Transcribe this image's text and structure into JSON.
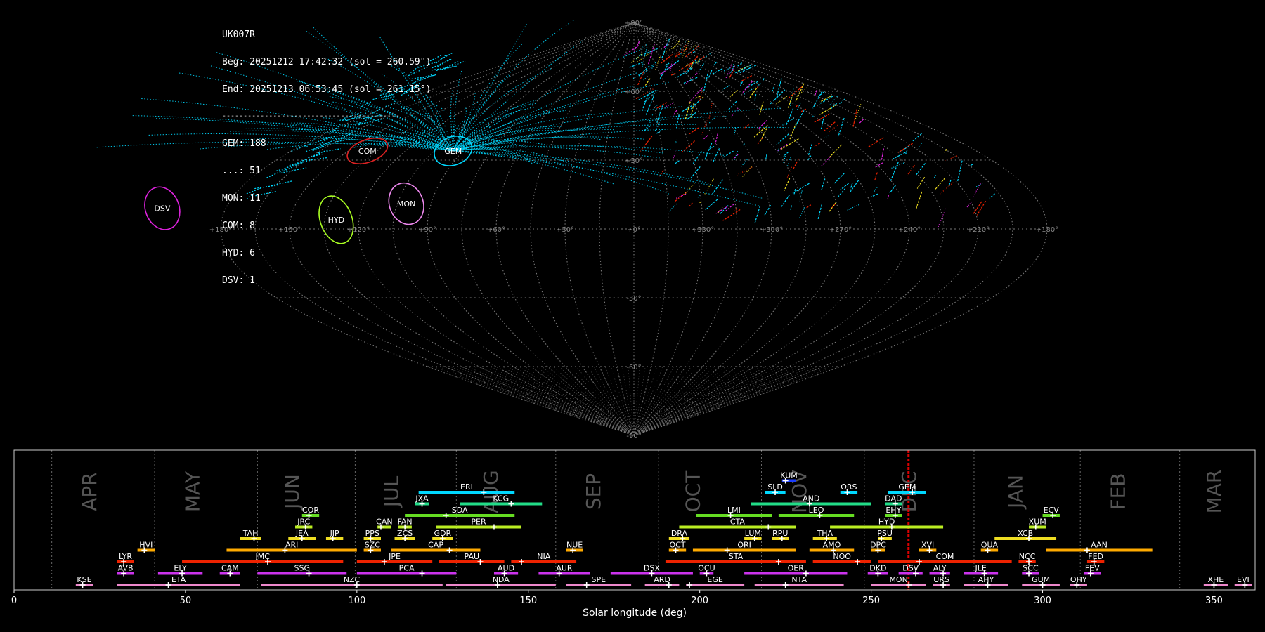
{
  "info_text": {
    "station": "UK007R",
    "begin": "Beg: 20251212 17:42:32 (sol = 260.59°)",
    "end": "End: 20251213 06:53:45 (sol = 261.15°)",
    "separator": "------------------------------------------",
    "counts": [
      "GEM: 188",
      "...: 51",
      "MON: 11",
      "COM: 8",
      "HYD: 6",
      "DSV: 1"
    ]
  },
  "colors": {
    "background": "#000000",
    "meteor_cyan": "#00d8ff",
    "grid": "#777777",
    "tick_text": "#888888",
    "month_text": "#555555",
    "sol_marker": "#dd0000",
    "frame": "#cccccc"
  },
  "chart_data": [
    {
      "type": "scatter",
      "projection": "sinusoidal (all-sky, ecliptic-centered longitude)",
      "x_tick_labels": [
        "+180°",
        "+150°",
        "+120°",
        "+90°",
        "+60°",
        "+30°",
        "+0°",
        "+330°",
        "+300°",
        "+270°",
        "+240°",
        "+210°",
        "+180°"
      ],
      "y_tick_labels": [
        "+90°",
        "+60°",
        "+30°",
        "-30°",
        "-60°",
        "-90°"
      ],
      "radiants": [
        {
          "code": "GEM",
          "lon": 95,
          "lat": 34,
          "rx": 0.55,
          "ry": 0.4,
          "color": "#00d8ff"
        },
        {
          "code": "COM",
          "lon": 140,
          "lat": 34,
          "rx": 0.6,
          "ry": 0.32,
          "color": "#dd2222"
        },
        {
          "code": "MON",
          "lon": 101,
          "lat": 11,
          "rx": 0.48,
          "ry": 0.6,
          "color": "#ee88ee"
        },
        {
          "code": "HYD",
          "lon": 130,
          "lat": 4,
          "rx": 0.45,
          "ry": 0.7,
          "color": "#aaff22"
        },
        {
          "code": "DSV",
          "lon": 208,
          "lat": 9,
          "rx": 0.48,
          "ry": 0.62,
          "color": "#dd22dd"
        }
      ]
    },
    {
      "type": "timeline",
      "xlabel": "Solar longitude (deg)",
      "xlim": [
        0,
        362
      ],
      "x_ticks": [
        0,
        50,
        100,
        150,
        200,
        250,
        300,
        350
      ],
      "current_sol": 260.9,
      "month_boundaries": [
        11,
        41,
        71,
        99.5,
        129,
        158,
        188,
        218,
        248,
        280,
        311,
        340
      ],
      "months": [
        {
          "name": "APR",
          "at": 24
        },
        {
          "name": "MAY",
          "at": 54
        },
        {
          "name": "JUN",
          "at": 83
        },
        {
          "name": "JUL",
          "at": 112
        },
        {
          "name": "AUG",
          "at": 141
        },
        {
          "name": "SEP",
          "at": 171
        },
        {
          "name": "OCT",
          "at": 200
        },
        {
          "name": "NOV",
          "at": 231
        },
        {
          "name": "DEC",
          "at": 263
        },
        {
          "name": "JAN",
          "at": 294
        },
        {
          "name": "FEB",
          "at": 324
        },
        {
          "name": "MAR",
          "at": 352
        }
      ],
      "showers": [
        {
          "code": "KUM",
          "s": 224,
          "e": 228,
          "p": 225,
          "row": 9,
          "color": "#1a3cff"
        },
        {
          "code": "ERI",
          "s": 118,
          "e": 146,
          "p": 137,
          "row": 8,
          "color": "#00d8ff"
        },
        {
          "code": "SLD",
          "s": 219,
          "e": 225,
          "p": 222,
          "row": 8,
          "color": "#00d8ff"
        },
        {
          "code": "ORS",
          "s": 241,
          "e": 246,
          "p": 243,
          "row": 8,
          "color": "#00d8ff"
        },
        {
          "code": "GEM",
          "s": 255,
          "e": 266,
          "p": 262,
          "row": 8,
          "color": "#00d8ff"
        },
        {
          "code": "JXA",
          "s": 117,
          "e": 121,
          "p": 119,
          "row": 7,
          "color": "#22dd88"
        },
        {
          "code": "KCG",
          "s": 130,
          "e": 154,
          "p": 145,
          "row": 7,
          "color": "#22dd88"
        },
        {
          "code": "AND",
          "s": 215,
          "e": 250,
          "p": 232,
          "row": 7,
          "color": "#22dd88"
        },
        {
          "code": "DAD",
          "s": 254,
          "e": 259,
          "p": 257,
          "row": 7,
          "color": "#22dd88"
        },
        {
          "code": "COR",
          "s": 84,
          "e": 89,
          "p": 86,
          "row": 6,
          "color": "#66dd22"
        },
        {
          "code": "SDA",
          "s": 114,
          "e": 146,
          "p": 126,
          "row": 6,
          "color": "#66dd22"
        },
        {
          "code": "LMI",
          "s": 199,
          "e": 221,
          "p": 209,
          "row": 6,
          "color": "#66dd22"
        },
        {
          "code": "LEO",
          "s": 223,
          "e": 245,
          "p": 235,
          "row": 6,
          "color": "#66dd22"
        },
        {
          "code": "EHY",
          "s": 254,
          "e": 259,
          "p": 257,
          "row": 6,
          "color": "#66dd22"
        },
        {
          "code": "ECV",
          "s": 300,
          "e": 305,
          "p": 303,
          "row": 6,
          "color": "#66dd22"
        },
        {
          "code": "JRC",
          "s": 82,
          "e": 87,
          "p": 85,
          "row": 5,
          "color": "#bbee22"
        },
        {
          "code": "CAN",
          "s": 106,
          "e": 110,
          "p": 107,
          "row": 5,
          "color": "#bbee22"
        },
        {
          "code": "FAN",
          "s": 112,
          "e": 116,
          "p": 114,
          "row": 5,
          "color": "#bbee22"
        },
        {
          "code": "PER",
          "s": 123,
          "e": 148,
          "p": 140,
          "row": 5,
          "color": "#bbee22"
        },
        {
          "code": "CTA",
          "s": 194,
          "e": 228,
          "p": 220,
          "row": 5,
          "color": "#bbee22"
        },
        {
          "code": "HYD",
          "s": 238,
          "e": 271,
          "p": 256,
          "row": 5,
          "color": "#bbee22"
        },
        {
          "code": "XUM",
          "s": 296,
          "e": 301,
          "p": 298,
          "row": 5,
          "color": "#bbee22"
        },
        {
          "code": "TAH",
          "s": 66,
          "e": 72,
          "p": 70,
          "row": 4,
          "color": "#eedd22"
        },
        {
          "code": "JEA",
          "s": 80,
          "e": 88,
          "p": 84,
          "row": 4,
          "color": "#eedd22"
        },
        {
          "code": "JIP",
          "s": 91,
          "e": 96,
          "p": 93,
          "row": 4,
          "color": "#eedd22"
        },
        {
          "code": "PPS",
          "s": 102,
          "e": 107,
          "p": 104,
          "row": 4,
          "color": "#eedd22"
        },
        {
          "code": "ZCS",
          "s": 111,
          "e": 117,
          "p": 114,
          "row": 4,
          "color": "#eedd22"
        },
        {
          "code": "GDR",
          "s": 122,
          "e": 128,
          "p": 125,
          "row": 4,
          "color": "#eedd22"
        },
        {
          "code": "DRA",
          "s": 191,
          "e": 197,
          "p": 195,
          "row": 4,
          "color": "#eedd22"
        },
        {
          "code": "LUM",
          "s": 213,
          "e": 218,
          "p": 216,
          "row": 4,
          "color": "#eedd22"
        },
        {
          "code": "RPU",
          "s": 221,
          "e": 226,
          "p": 224,
          "row": 4,
          "color": "#eedd22"
        },
        {
          "code": "THA",
          "s": 233,
          "e": 240,
          "p": 237,
          "row": 4,
          "color": "#eedd22"
        },
        {
          "code": "PSU",
          "s": 252,
          "e": 256,
          "p": 253,
          "row": 4,
          "color": "#eedd22"
        },
        {
          "code": "XCB",
          "s": 286,
          "e": 304,
          "p": 296,
          "row": 4,
          "color": "#eedd22"
        },
        {
          "code": "HVI",
          "s": 36,
          "e": 41,
          "p": 38,
          "row": 3,
          "color": "#ffaa00"
        },
        {
          "code": "ARI",
          "s": 62,
          "e": 100,
          "p": 79,
          "row": 3,
          "color": "#ffaa00"
        },
        {
          "code": "SZC",
          "s": 102,
          "e": 107,
          "p": 104,
          "row": 3,
          "color": "#ffaa00"
        },
        {
          "code": "CAP",
          "s": 110,
          "e": 136,
          "p": 127,
          "row": 3,
          "color": "#ffaa00"
        },
        {
          "code": "NUE",
          "s": 161,
          "e": 166,
          "p": 163,
          "row": 3,
          "color": "#ffaa00"
        },
        {
          "code": "OCT",
          "s": 191,
          "e": 196,
          "p": 193,
          "row": 3,
          "color": "#ffaa00"
        },
        {
          "code": "ORI",
          "s": 198,
          "e": 228,
          "p": 208,
          "row": 3,
          "color": "#ffaa00"
        },
        {
          "code": "AMO",
          "s": 232,
          "e": 245,
          "p": 239,
          "row": 3,
          "color": "#ffaa00"
        },
        {
          "code": "DPC",
          "s": 250,
          "e": 254,
          "p": 252,
          "row": 3,
          "color": "#ffaa00"
        },
        {
          "code": "XVI",
          "s": 264,
          "e": 269,
          "p": 267,
          "row": 3,
          "color": "#ffaa00"
        },
        {
          "code": "QUA",
          "s": 282,
          "e": 287,
          "p": 284,
          "row": 3,
          "color": "#ffaa00"
        },
        {
          "code": "AAN",
          "s": 301,
          "e": 332,
          "p": 313,
          "row": 3,
          "color": "#ffaa00"
        },
        {
          "code": "LYR",
          "s": 30,
          "e": 35,
          "p": 32,
          "row": 2,
          "color": "#ee2200"
        },
        {
          "code": "JMC",
          "s": 49,
          "e": 96,
          "p": 74,
          "row": 2,
          "color": "#ee2200"
        },
        {
          "code": "JPE",
          "s": 100,
          "e": 122,
          "p": 108,
          "row": 2,
          "color": "#ee2200"
        },
        {
          "code": "PAU",
          "s": 124,
          "e": 143,
          "p": 136,
          "row": 2,
          "color": "#ee2200"
        },
        {
          "code": "NIA",
          "s": 145,
          "e": 164,
          "p": 148,
          "row": 2,
          "color": "#ee2200"
        },
        {
          "code": "STA",
          "s": 190,
          "e": 231,
          "p": 223,
          "row": 2,
          "color": "#ee2200"
        },
        {
          "code": "NOO",
          "s": 233,
          "e": 250,
          "p": 246,
          "row": 2,
          "color": "#ee2200"
        },
        {
          "code": "COM",
          "s": 252,
          "e": 291,
          "p": 264,
          "row": 2,
          "color": "#ee2200"
        },
        {
          "code": "NCC",
          "s": 293,
          "e": 298,
          "p": 296,
          "row": 2,
          "color": "#ee2200"
        },
        {
          "code": "FED",
          "s": 313,
          "e": 318,
          "p": 315,
          "row": 2,
          "color": "#ee2200"
        },
        {
          "code": "AVB",
          "s": 30,
          "e": 35,
          "p": 32,
          "row": 1,
          "color": "#cc33ee"
        },
        {
          "code": "ELY",
          "s": 42,
          "e": 55,
          "p": 49,
          "row": 1,
          "color": "#cc33ee"
        },
        {
          "code": "CAM",
          "s": 60,
          "e": 66,
          "p": 63,
          "row": 1,
          "color": "#cc33ee"
        },
        {
          "code": "SSG",
          "s": 71,
          "e": 97,
          "p": 86,
          "row": 1,
          "color": "#cc33ee"
        },
        {
          "code": "PCA",
          "s": 100,
          "e": 129,
          "p": 119,
          "row": 1,
          "color": "#cc33ee"
        },
        {
          "code": "AUD",
          "s": 140,
          "e": 147,
          "p": 143,
          "row": 1,
          "color": "#cc33ee"
        },
        {
          "code": "AUR",
          "s": 153,
          "e": 168,
          "p": 159,
          "row": 1,
          "color": "#cc33ee"
        },
        {
          "code": "DSX",
          "s": 174,
          "e": 198,
          "p": 186,
          "row": 1,
          "color": "#cc33ee"
        },
        {
          "code": "OCU",
          "s": 200,
          "e": 204,
          "p": 202,
          "row": 1,
          "color": "#cc33ee"
        },
        {
          "code": "OER",
          "s": 213,
          "e": 243,
          "p": 231,
          "row": 1,
          "color": "#cc33ee"
        },
        {
          "code": "DKD",
          "s": 249,
          "e": 255,
          "p": 252,
          "row": 1,
          "color": "#cc33ee"
        },
        {
          "code": "DSV",
          "s": 258,
          "e": 265,
          "p": 263,
          "row": 1,
          "color": "#cc33ee"
        },
        {
          "code": "ALY",
          "s": 267,
          "e": 273,
          "p": 271,
          "row": 1,
          "color": "#cc33ee"
        },
        {
          "code": "JLE",
          "s": 277,
          "e": 287,
          "p": 283,
          "row": 1,
          "color": "#cc33ee"
        },
        {
          "code": "SCC",
          "s": 294,
          "e": 299,
          "p": 296,
          "row": 1,
          "color": "#cc33ee"
        },
        {
          "code": "FEV",
          "s": 312,
          "e": 317,
          "p": 314,
          "row": 1,
          "color": "#cc33ee"
        },
        {
          "code": "KSE",
          "s": 18,
          "e": 23,
          "p": 20,
          "row": 0,
          "color": "#ee88cc"
        },
        {
          "code": "ETA",
          "s": 30,
          "e": 66,
          "p": 45,
          "row": 0,
          "color": "#ee88cc"
        },
        {
          "code": "NZC",
          "s": 72,
          "e": 125,
          "p": 100,
          "row": 0,
          "color": "#ee88cc"
        },
        {
          "code": "NDA",
          "s": 126,
          "e": 158,
          "p": 141,
          "row": 0,
          "color": "#ee88cc"
        },
        {
          "code": "SPE",
          "s": 161,
          "e": 180,
          "p": 167,
          "row": 0,
          "color": "#ee88cc"
        },
        {
          "code": "ARD",
          "s": 184,
          "e": 194,
          "p": 191,
          "row": 0,
          "color": "#ee88cc"
        },
        {
          "code": "EGE",
          "s": 196,
          "e": 213,
          "p": 197,
          "row": 0,
          "color": "#ee88cc"
        },
        {
          "code": "NTA",
          "s": 216,
          "e": 242,
          "p": 225,
          "row": 0,
          "color": "#ee88cc"
        },
        {
          "code": "MON",
          "s": 250,
          "e": 266,
          "p": 261,
          "row": 0,
          "color": "#ee88cc"
        },
        {
          "code": "URS",
          "s": 268,
          "e": 273,
          "p": 271,
          "row": 0,
          "color": "#ee88cc"
        },
        {
          "code": "AHY",
          "s": 277,
          "e": 290,
          "p": 284,
          "row": 0,
          "color": "#ee88cc"
        },
        {
          "code": "GUM",
          "s": 294,
          "e": 305,
          "p": 300,
          "row": 0,
          "color": "#ee88cc"
        },
        {
          "code": "OHY",
          "s": 308,
          "e": 313,
          "p": 310,
          "row": 0,
          "color": "#ee88cc"
        },
        {
          "code": "XHE",
          "s": 347,
          "e": 354,
          "p": 350,
          "row": 0,
          "color": "#ee88cc"
        },
        {
          "code": "EVI",
          "s": 356,
          "e": 361,
          "p": 359,
          "row": 0,
          "color": "#ee88cc"
        }
      ]
    }
  ]
}
